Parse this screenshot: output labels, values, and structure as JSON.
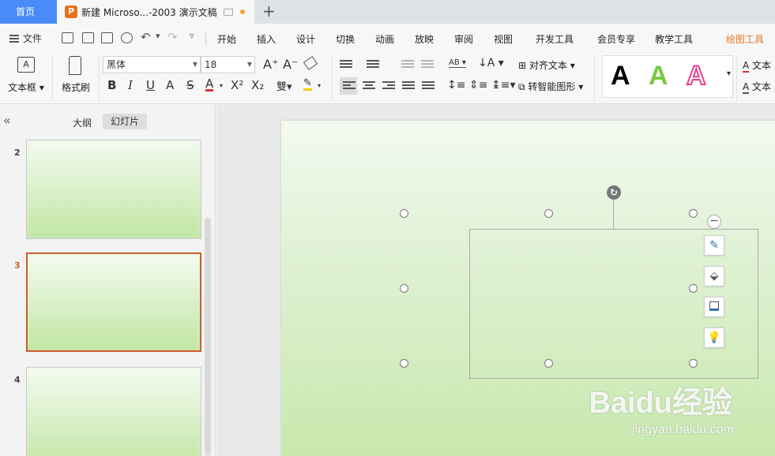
{
  "tabs": {
    "home": "首页",
    "doc_title": "新建 Microso...-2003 演示文稿",
    "logo_letter": "P"
  },
  "menu": {
    "file": "文件",
    "items": [
      "开始",
      "插入",
      "设计",
      "切换",
      "动画",
      "放映",
      "审阅",
      "视图",
      "开发工具",
      "会员专享",
      "教学工具",
      "绘图工具"
    ],
    "active": "绘图工具"
  },
  "ribbon": {
    "textbox_label": "文本框",
    "format_painter": "格式刷",
    "font_name": "黑体",
    "font_size": "18",
    "align_text": "对齐文本",
    "smart_shape": "转智能图形",
    "text_fill": "文本",
    "text_outline": "文本",
    "wordart_colors": [
      "#000000",
      "#7ac943",
      "#e8408a"
    ]
  },
  "left_panel": {
    "outline_tab": "大纲",
    "slides_tab": "幻灯片",
    "slide_numbers": [
      "2",
      "3",
      "4"
    ],
    "selected_slide": "3"
  },
  "watermark": {
    "logo": "Baidu经验",
    "url": "jingyan.baidu.com"
  }
}
